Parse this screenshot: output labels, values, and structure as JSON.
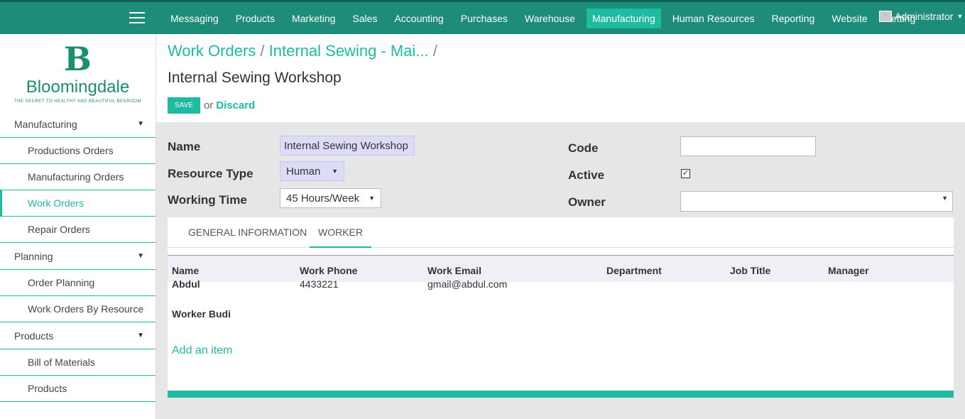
{
  "topbar": {
    "menu": [
      "Messaging",
      "Products",
      "Marketing",
      "Sales",
      "Accounting",
      "Purchases",
      "Warehouse",
      "Manufacturing",
      "Human Resources",
      "Reporting",
      "Website",
      "Setting"
    ],
    "active": "Manufacturing",
    "user": "Administrator",
    "accent": "#1fbba0",
    "bar_color": "#1d8d7a"
  },
  "logo": {
    "mark": "B",
    "brand": "Bloomingdale",
    "tagline": "THE SECRET TO HEALTHY AND BEAUTIFUL BEDROOM"
  },
  "sidebar": {
    "sections": [
      {
        "label": "Manufacturing",
        "items": [
          "Productions Orders",
          "Manufacturing Orders",
          "Work Orders",
          "Repair Orders"
        ]
      },
      {
        "label": "Planning",
        "items": [
          "Order Planning",
          "Work Orders By Resource"
        ]
      },
      {
        "label": "Products",
        "items": [
          "Bill of Materials",
          "Products"
        ]
      }
    ],
    "active_item": "Work Orders"
  },
  "breadcrumb": {
    "items": [
      "Work Orders",
      "Internal Sewing - Mai..."
    ],
    "separator": "/"
  },
  "page": {
    "title": "Internal Sewing Workshop",
    "save": "SAVE",
    "or": "or",
    "discard": "Discard"
  },
  "form": {
    "name_label": "Name",
    "name_value": "Internal Sewing Workshop",
    "resource_type_label": "Resource Type",
    "resource_type_value": "Human",
    "working_time_label": "Working Time",
    "working_time_value": "45 Hours/Week",
    "code_label": "Code",
    "code_value": "",
    "active_label": "Active",
    "active_checked": true,
    "active_mark": "✓",
    "owner_label": "Owner",
    "owner_value": ""
  },
  "tabs": [
    "GENERAL INFORMATION",
    "WORKER"
  ],
  "active_tab": "WORKER",
  "table": {
    "columns": [
      "Name",
      "Work Phone",
      "Work Email",
      "Department",
      "Job Title",
      "Manager"
    ],
    "rows": [
      {
        "name": "Abdul",
        "phone": "4433221",
        "email": "gmail@abdul.com",
        "department": "",
        "job_title": "",
        "manager": ""
      },
      {
        "name": "Worker Budi",
        "phone": "",
        "email": "",
        "department": "",
        "job_title": "",
        "manager": ""
      }
    ],
    "add_item": "Add an item"
  }
}
